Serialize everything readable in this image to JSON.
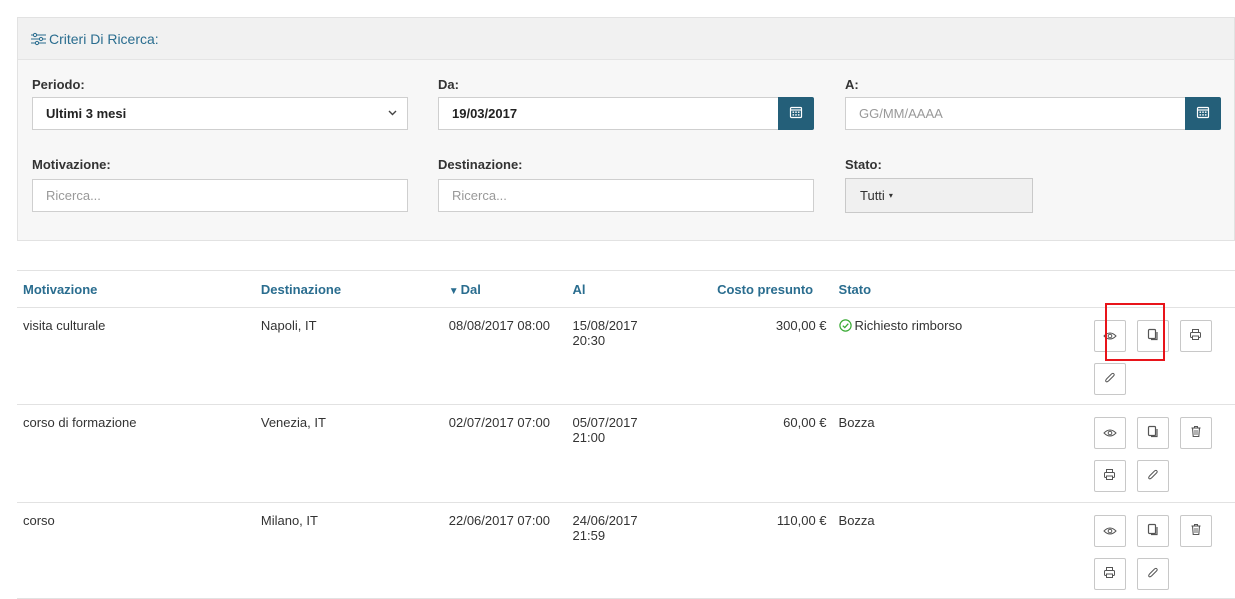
{
  "search": {
    "title": "Criteri Di Ricerca:",
    "periodo_label": "Periodo:",
    "periodo_value": "Ultimi 3 mesi",
    "da_label": "Da:",
    "da_value": "19/03/2017",
    "a_label": "A:",
    "a_placeholder": "GG/MM/AAAA",
    "motivazione_label": "Motivazione:",
    "motivazione_placeholder": "Ricerca...",
    "destinazione_label": "Destinazione:",
    "destinazione_placeholder": "Ricerca...",
    "stato_label": "Stato:",
    "stato_value": "Tutti"
  },
  "table": {
    "headers": {
      "motivazione": "Motivazione",
      "destinazione": "Destinazione",
      "dal": "Dal",
      "al": "Al",
      "costo": "Costo presunto",
      "stato": "Stato"
    },
    "rows": [
      {
        "motivazione": "visita culturale",
        "destinazione": "Napoli, IT",
        "dal": "08/08/2017 08:00",
        "al": "15/08/2017 20:30",
        "costo": "300,00 €",
        "stato": "Richiesto rimborso"
      },
      {
        "motivazione": "corso di formazione",
        "destinazione": "Venezia, IT",
        "dal": "02/07/2017 07:00",
        "al": "05/07/2017 21:00",
        "costo": "60,00 €",
        "stato": "Bozza"
      },
      {
        "motivazione": "corso",
        "destinazione": "Milano, IT",
        "dal": "22/06/2017 07:00",
        "al": "24/06/2017 21:59",
        "costo": "110,00 €",
        "stato": "Bozza"
      }
    ]
  },
  "colors": {
    "accent": "#2a6d8f",
    "calendar_button": "#245f79",
    "highlight": "#e8141a",
    "status_ok": "#3aaa35"
  }
}
